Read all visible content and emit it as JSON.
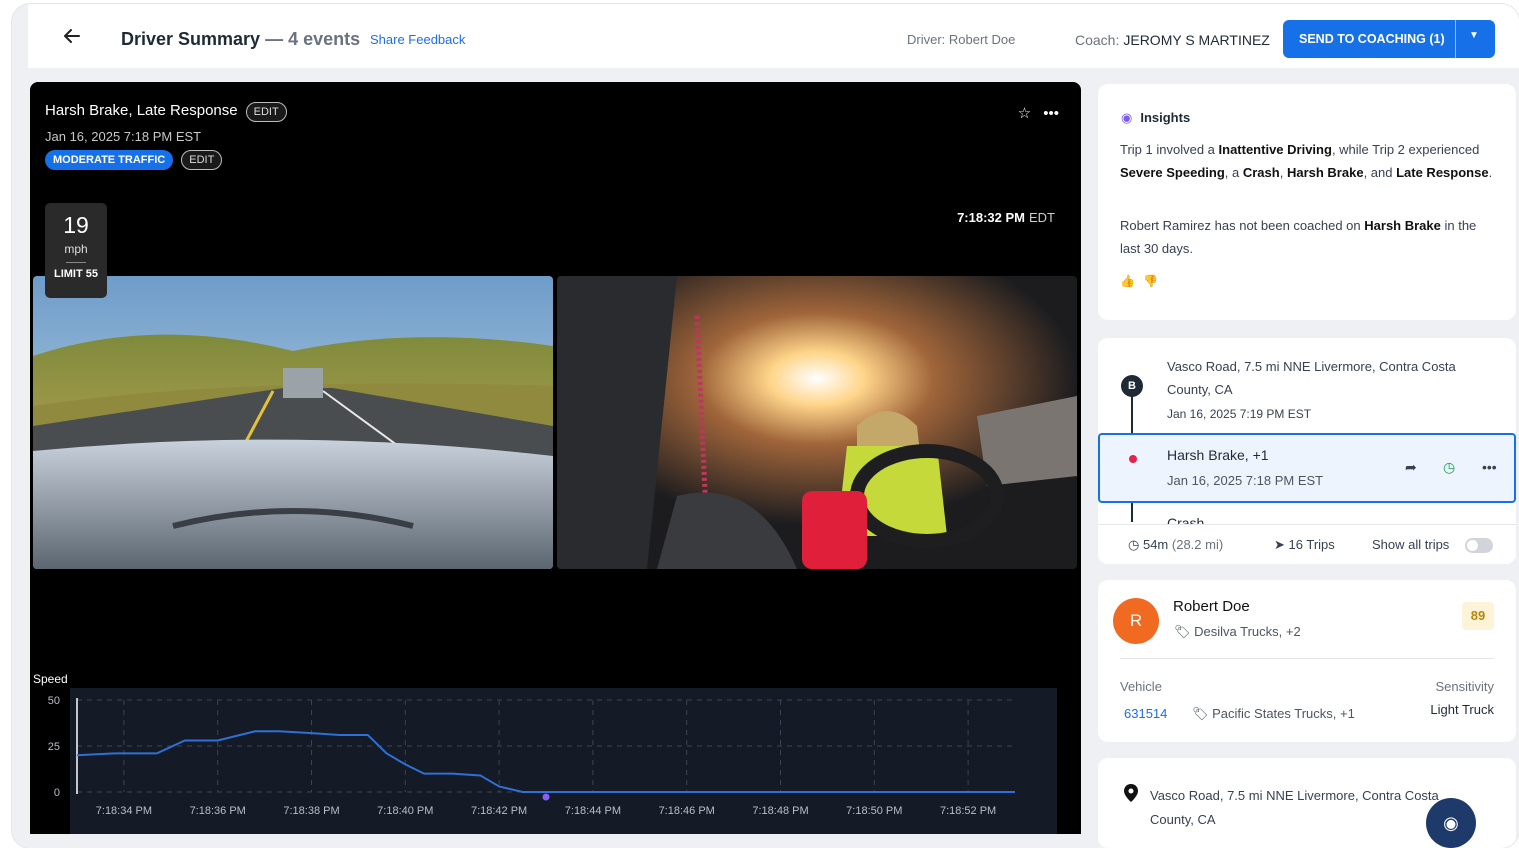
{
  "header": {
    "back_icon": "arrow-left-icon",
    "title": "Driver Summary",
    "events": "— 4 events",
    "share_feedback": "Share Feedback",
    "driver": "Driver: Robert Doe",
    "coach_label": "Coach:",
    "coach_name": "JEROMY S MARTINEZ",
    "send_button": "SEND TO COACHING (1)"
  },
  "event": {
    "title": "Harsh Brake, Late Response",
    "edit": "EDIT",
    "date": "Jan 16, 2025 7:18 PM EST",
    "traffic_tag": "MODERATE TRAFFIC",
    "tag_edit": "EDIT",
    "speed_value": "19",
    "speed_unit": "mph",
    "speed_limit": "LIMIT 55",
    "clock_time": "7:18:32 PM",
    "clock_tz": "EDT",
    "star_icon": "star-icon",
    "more_icon": "more-horizontal-icon"
  },
  "chart_data": {
    "type": "line",
    "title": "Speed",
    "ylim": [
      0,
      50
    ],
    "yticks": [
      0,
      25,
      50
    ],
    "xticks": [
      "7:18:34 PM",
      "7:18:36 PM",
      "7:18:38 PM",
      "7:18:40 PM",
      "7:18:42 PM",
      "7:18:44 PM",
      "7:18:46 PM",
      "7:18:48 PM",
      "7:18:50 PM",
      "7:18:52 PM"
    ],
    "grid": true,
    "series": [
      {
        "color": "#2f6fd6",
        "x": [
          0,
          0.8,
          1.0,
          1.7,
          2.3,
          3.0,
          3.8,
          4.3,
          5.0,
          5.6,
          6.2,
          6.6,
          7.0,
          7.4,
          8.0,
          8.6,
          9.0,
          9.5,
          10.0,
          12,
          16,
          20
        ],
        "y": [
          20,
          21,
          21,
          21,
          28,
          28,
          33,
          33,
          32,
          31,
          31,
          21,
          15,
          10,
          10,
          9,
          3,
          0,
          0,
          0,
          0,
          0
        ]
      }
    ]
  },
  "insights": {
    "title": "Insights",
    "p1_a": "Trip 1 involved a ",
    "p1_b": "Inattentive Driving",
    "p1_c": ", while Trip 2 experienced ",
    "p1_d": "Severe Speeding",
    "p1_e": ", a ",
    "p1_f": "Crash",
    "p1_g": ", ",
    "p1_h": "Harsh Brake",
    "p1_i": ", and ",
    "p1_j": "Late Response",
    "p1_k": ".",
    "p2_a": "Robert Ramirez has not been coached on ",
    "p2_b": "Harsh Brake",
    "p2_c": " in the last 30 days."
  },
  "timeline": {
    "marker": "B",
    "location": "Vasco Road, 7.5 mi NNE Livermore, Contra Costa County, CA",
    "location_date": "Jan 16, 2025 7:19 PM EST",
    "selected_name": "Harsh Brake, +1",
    "selected_date": "Jan 16, 2025 7:18 PM EST",
    "next_event": "Crash",
    "duration": "54m",
    "distance": "(28.2 mi)",
    "trips": "16 Trips",
    "show_all": "Show all trips"
  },
  "driver": {
    "initial": "R",
    "name": "Robert Doe",
    "tag": "Desilva Trucks, +2",
    "score": "89",
    "vehicle_label": "Vehicle",
    "vehicle_id": "631514",
    "vehicle_tag": "Pacific States Trucks, +1",
    "sensitivity_label": "Sensitivity",
    "sensitivity_value": "Light Truck"
  },
  "location_card": {
    "text": "Vasco Road, 7.5 mi NNE Livermore, Contra Costa County, CA"
  },
  "colors": {
    "accent": "#1671e8",
    "avatar": "#f06a22",
    "score_bg": "#fdf3d8",
    "chart_bg": "#141b26"
  }
}
